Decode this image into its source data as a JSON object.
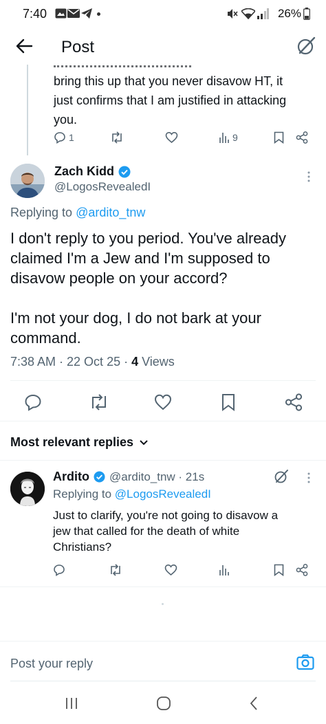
{
  "status_bar": {
    "time": "7:40",
    "battery": "26%"
  },
  "header": {
    "title": "Post"
  },
  "prev_post": {
    "text_lines": [
      "bring this up that you never disavow HT, it",
      "just confirms that I am justified in attacking",
      "you."
    ],
    "reply_count": "1",
    "views": "9"
  },
  "main_post": {
    "author_name": "Zach Kidd",
    "author_handle": "@LogosRevealedI",
    "replying_label": "Replying to ",
    "replying_to": "@ardito_tnw",
    "body_lines": [
      "I don't reply to you period. You've already",
      "claimed I'm a Jew and I'm supposed to",
      "disavow people on your accord?",
      "",
      "I'm not your dog, I do not bark at your",
      "command."
    ],
    "meta_time": "7:38 AM · 22 Oct 25 · ",
    "views_count": "4",
    "views_label": " Views"
  },
  "replies_section": {
    "sort_label": "Most relevant replies"
  },
  "reply": {
    "author_name": "Ardito",
    "author_handle": "@ardito_tnw · 21s",
    "replying_label": "Replying to ",
    "replying_to": "@LogosRevealedI",
    "body_lines": [
      "Just to clarify, you're not going to disavow a",
      "jew that called for the death of white",
      "Christians?"
    ]
  },
  "compose": {
    "placeholder": "Post your reply"
  },
  "colors": {
    "accent": "#1d9bf0",
    "text": "#0f1419",
    "muted": "#536471",
    "verified": "#1d9bf0"
  }
}
